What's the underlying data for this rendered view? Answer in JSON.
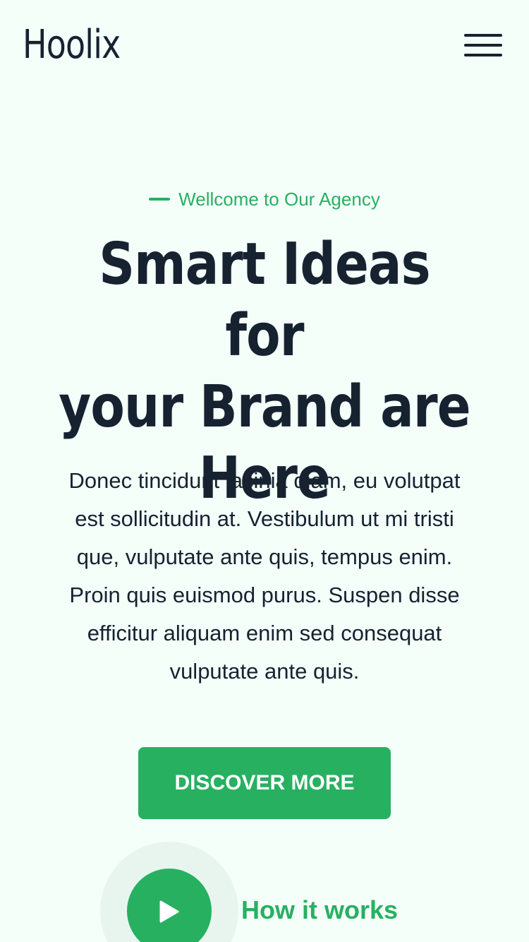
{
  "header": {
    "logo": "Hoolix",
    "menu_icon": "hamburger-menu-icon"
  },
  "hero": {
    "eyebrow": "Wellcome to Our Agency",
    "title_lines": [
      "Smart Ideas for",
      "your Brand are",
      "Here"
    ],
    "description_lines": [
      "Donec tincidunt lacinia diam, eu volutpat",
      "est sollicitudin at. Vestibulum ut mi tristi",
      "que, vulputate ante quis, tempus enim.",
      "Proin quis euismod purus. Suspen disse",
      "efficitur aliquam enim sed consequat",
      "vulputate ante quis."
    ],
    "cta_label": "DISCOVER MORE",
    "play_icon": "play-icon",
    "how_label": "How it works"
  },
  "colors": {
    "accent": "#28b061",
    "text": "#162230",
    "background": "#f4fffa"
  }
}
